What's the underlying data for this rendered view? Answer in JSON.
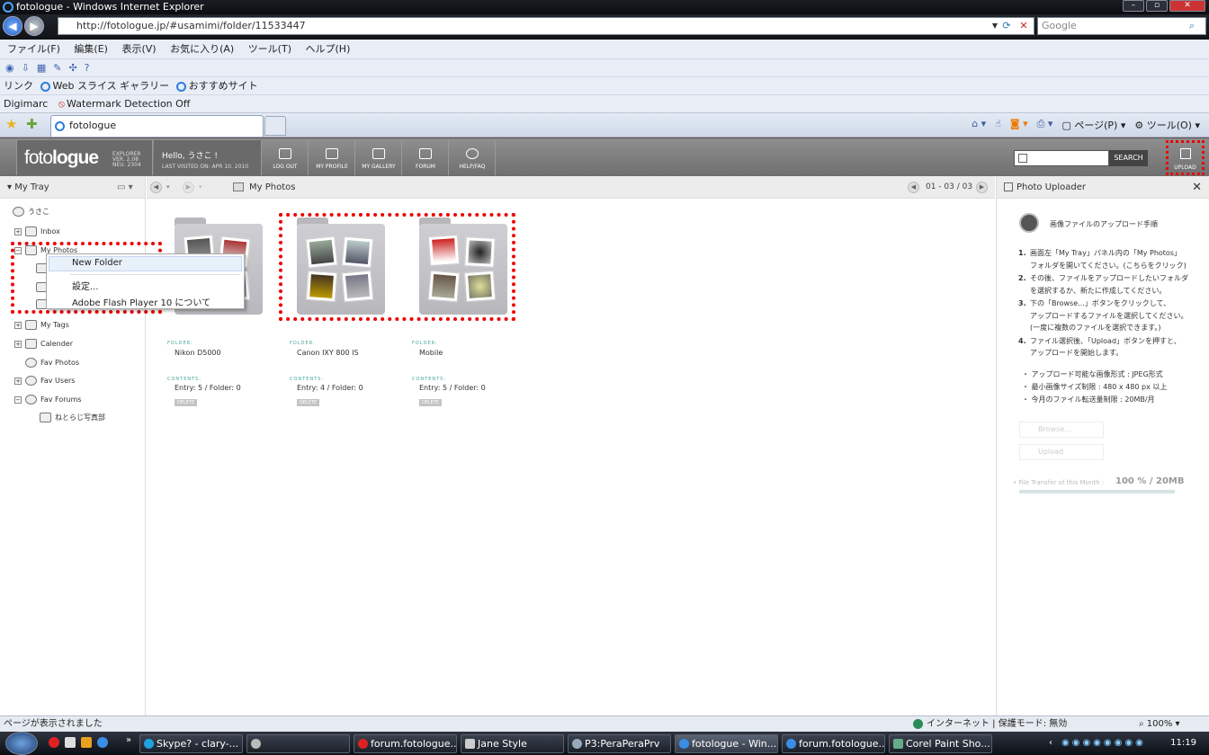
{
  "window": {
    "title": "fotologue - Windows Internet Explorer"
  },
  "nav": {
    "url": "http://fotologue.jp/#usamimi/folder/11533447",
    "search_placeholder": "Google"
  },
  "menu": [
    "ファイル(F)",
    "編集(E)",
    "表示(V)",
    "お気に入り(A)",
    "ツール(T)",
    "ヘルプ(H)"
  ],
  "links": {
    "label": "リンク",
    "items": [
      "Web スライス ギャラリー",
      "おすすめサイト"
    ]
  },
  "digimarc": {
    "label": "Digimarc",
    "item": "Watermark Detection Off"
  },
  "tab": {
    "title": "fotologue"
  },
  "cmd": {
    "page": "ページ(P)",
    "tools": "ツール(O)"
  },
  "app": {
    "logo_light": "foto",
    "logo_bold": "logue",
    "ver1": "EXPLORER",
    "ver2": "VER. 2.08",
    "ver3": "NEU. 2304",
    "hello": "Hello, うさこ !",
    "last_visit": "LAST VISITED ON: APR 10. 2010",
    "nav": [
      "LOG OUT",
      "MY PROFILE",
      "MY GALLERY",
      "FORUM",
      "HELP/FAQ"
    ],
    "search_btn": "SEARCH",
    "upload": "UPLOAD"
  },
  "tray": {
    "title": "My Tray",
    "items": [
      "うさこ",
      "Inbox",
      "My Photos",
      "My Tags",
      "Calender",
      "Fav Photos",
      "Fav Users",
      "Fav Forums",
      "ねとらじ写真部"
    ]
  },
  "context_menu": [
    "New Folder",
    "設定...",
    "Adobe Flash Player 10 について"
  ],
  "main": {
    "crumb": "My Photos",
    "page": "01 - 03 / 03"
  },
  "folders": [
    {
      "label": "FOLDER:",
      "name": "Nikon D5000",
      "contents_label": "CONTENTS:",
      "contents": "Entry: 5 / Folder: 0",
      "delete": "DELETE"
    },
    {
      "label": "FOLDER:",
      "name": "Canon IXY 800 IS",
      "contents_label": "CONTENTS:",
      "contents": "Entry: 4 / Folder: 0",
      "delete": "DELETE"
    },
    {
      "label": "FOLDER:",
      "name": "Mobile",
      "contents_label": "CONTENTS:",
      "contents": "Entry: 5 / Folder: 0",
      "delete": "DELETE"
    }
  ],
  "uploader": {
    "title": "Photo Uploader",
    "heading": "画像ファイルのアップロード手順",
    "steps": [
      {
        "n": "1.",
        "lines": [
          "画面左「My Tray」パネル内の「My Photos」",
          "フォルダを開いてください。(こちらをクリック)"
        ]
      },
      {
        "n": "2.",
        "lines": [
          "その後、ファイルをアップロードしたいフォルダ",
          "を選択するか、新たに作成してください。"
        ]
      },
      {
        "n": "3.",
        "lines": [
          "下の「Browse...」ボタンをクリックして、",
          "アップロードするファイルを選択してください。",
          "(一度に複数のファイルを選択できます。)"
        ]
      },
      {
        "n": "4.",
        "lines": [
          "ファイル選択後、「Upload」ボタンを押すと、",
          "アップロードを開始します。"
        ]
      }
    ],
    "notes": [
      "アップロード可能な画像形式 : JPEG形式",
      "最小画像サイズ制限 : 480 x 480 px 以上",
      "今月のファイル転送量制限 : 20MB/月"
    ],
    "browse": "Browse...",
    "upload": "Upload",
    "transfer_label": "File Transfer of this Month :",
    "transfer_value": "100 % / 20MB"
  },
  "status": {
    "left": "ページが表示されました",
    "zone": "インターネット | 保護モード: 無効",
    "zoom": "100%"
  },
  "taskbar": {
    "tasks": [
      "Skype? - clary-...",
      "",
      "forum.fotologue...",
      "Jane Style",
      "P3:PeraPeraPrv",
      "fotologue - Win...",
      "forum.fotologue...",
      "Corel Paint Sho..."
    ],
    "clock": "11:19"
  }
}
